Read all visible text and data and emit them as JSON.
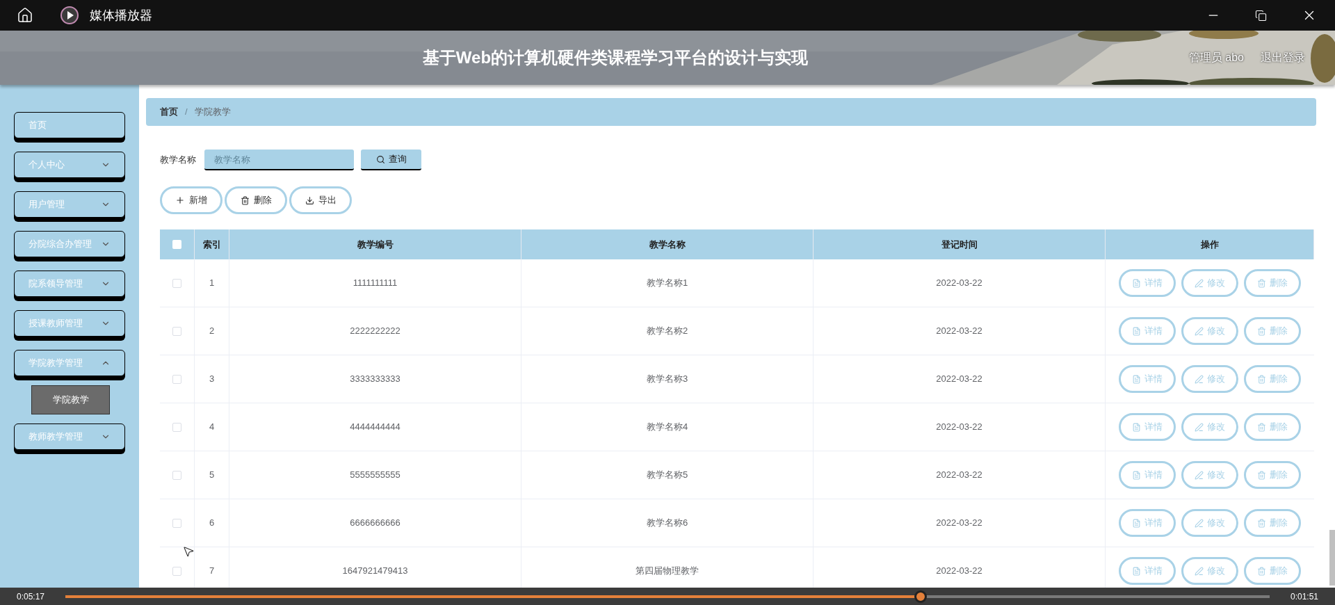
{
  "player": {
    "title": "媒体播放器",
    "current_time": "0:05:17",
    "total_time": "0:01:51",
    "level": 0.71
  },
  "header": {
    "title": "基于Web的计算机硬件类课程学习平台的设计与实现",
    "user": "管理员 abo",
    "logout": "退出登录"
  },
  "sidebar": {
    "items": [
      {
        "label": "首页",
        "kind": "link"
      },
      {
        "label": "个人中心",
        "kind": "menu",
        "expanded": false
      },
      {
        "label": "用户管理",
        "kind": "menu",
        "expanded": false
      },
      {
        "label": "分院综合办管理",
        "kind": "menu",
        "expanded": false
      },
      {
        "label": "院系领导管理",
        "kind": "menu",
        "expanded": false
      },
      {
        "label": "授课教师管理",
        "kind": "menu",
        "expanded": false
      },
      {
        "label": "学院教学管理",
        "kind": "menu",
        "expanded": true,
        "children": [
          {
            "label": "学院教学",
            "selected": true
          }
        ]
      },
      {
        "label": "教师教学管理",
        "kind": "menu",
        "expanded": false
      }
    ]
  },
  "breadcrumb": {
    "separator": "/",
    "items": [
      "首页",
      "学院教学"
    ]
  },
  "search": {
    "label": "教学名称",
    "placeholder": "教学名称",
    "button": "查询"
  },
  "toolbar": [
    {
      "label": "新增",
      "kind": "add"
    },
    {
      "label": "删除",
      "kind": "delete"
    },
    {
      "label": "导出",
      "kind": "export"
    }
  ],
  "table": {
    "header_checked": false,
    "columns": [
      "索引",
      "教学编号",
      "教学名称",
      "登记时间",
      "操作"
    ],
    "rows": [
      {
        "checked": false,
        "index": "1",
        "code": "1111111111",
        "name": "教学名称1",
        "date": "2022-03-22",
        "actions": [
          {
            "label": "详情",
            "kind": "detail"
          },
          {
            "label": "修改",
            "kind": "edit"
          },
          {
            "label": "删除",
            "kind": "delete"
          }
        ]
      },
      {
        "checked": false,
        "index": "2",
        "code": "2222222222",
        "name": "教学名称2",
        "date": "2022-03-22",
        "actions": [
          {
            "label": "详情",
            "kind": "detail"
          },
          {
            "label": "修改",
            "kind": "edit"
          },
          {
            "label": "删除",
            "kind": "delete"
          }
        ]
      },
      {
        "checked": false,
        "index": "3",
        "code": "3333333333",
        "name": "教学名称3",
        "date": "2022-03-22",
        "actions": [
          {
            "label": "详情",
            "kind": "detail"
          },
          {
            "label": "修改",
            "kind": "edit"
          },
          {
            "label": "删除",
            "kind": "delete"
          }
        ]
      },
      {
        "checked": false,
        "index": "4",
        "code": "4444444444",
        "name": "教学名称4",
        "date": "2022-03-22",
        "actions": [
          {
            "label": "详情",
            "kind": "detail"
          },
          {
            "label": "修改",
            "kind": "edit"
          },
          {
            "label": "删除",
            "kind": "delete"
          }
        ]
      },
      {
        "checked": false,
        "index": "5",
        "code": "5555555555",
        "name": "教学名称5",
        "date": "2022-03-22",
        "actions": [
          {
            "label": "详情",
            "kind": "detail"
          },
          {
            "label": "修改",
            "kind": "edit"
          },
          {
            "label": "删除",
            "kind": "delete"
          }
        ]
      },
      {
        "checked": false,
        "index": "6",
        "code": "6666666666",
        "name": "教学名称6",
        "date": "2022-03-22",
        "actions": [
          {
            "label": "详情",
            "kind": "detail"
          },
          {
            "label": "修改",
            "kind": "edit"
          },
          {
            "label": "删除",
            "kind": "delete"
          }
        ]
      },
      {
        "checked": false,
        "index": "7",
        "code": "1647921479413",
        "name": "第四届物理教学",
        "date": "2022-03-22",
        "actions": [
          {
            "label": "详情",
            "kind": "detail"
          },
          {
            "label": "修改",
            "kind": "edit"
          },
          {
            "label": "删除",
            "kind": "delete"
          }
        ]
      }
    ]
  }
}
